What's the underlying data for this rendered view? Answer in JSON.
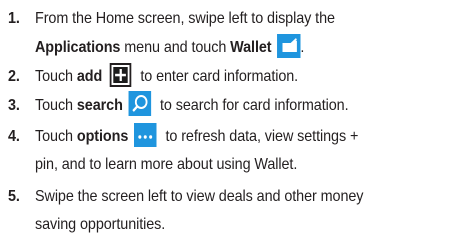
{
  "steps": [
    {
      "number": "1.",
      "line1": "From the Home screen, swipe left to display the",
      "line2_bold1": "Applications",
      "line2_text": " menu and touch ",
      "line2_bold2": "Wallet",
      "line2_end": ".",
      "icon": "wallet-icon"
    },
    {
      "number": "2.",
      "pre": "Touch ",
      "bold": "add",
      "post": " to enter card information.",
      "icon": "add-icon"
    },
    {
      "number": "3.",
      "pre": "Touch ",
      "bold": "search",
      "post": " to search for card information.",
      "icon": "search-icon"
    },
    {
      "number": "4.",
      "pre": "Touch ",
      "bold": "options",
      "post": " to refresh data, view settings +",
      "line2": "pin, and to learn more about using Wallet.",
      "icon": "options-icon"
    },
    {
      "number": "5.",
      "line1": "Swipe the screen left to view deals and other money",
      "line2": "saving opportunities."
    }
  ],
  "colors": {
    "icon_blue": "#1f95de",
    "text": "#231f20"
  }
}
